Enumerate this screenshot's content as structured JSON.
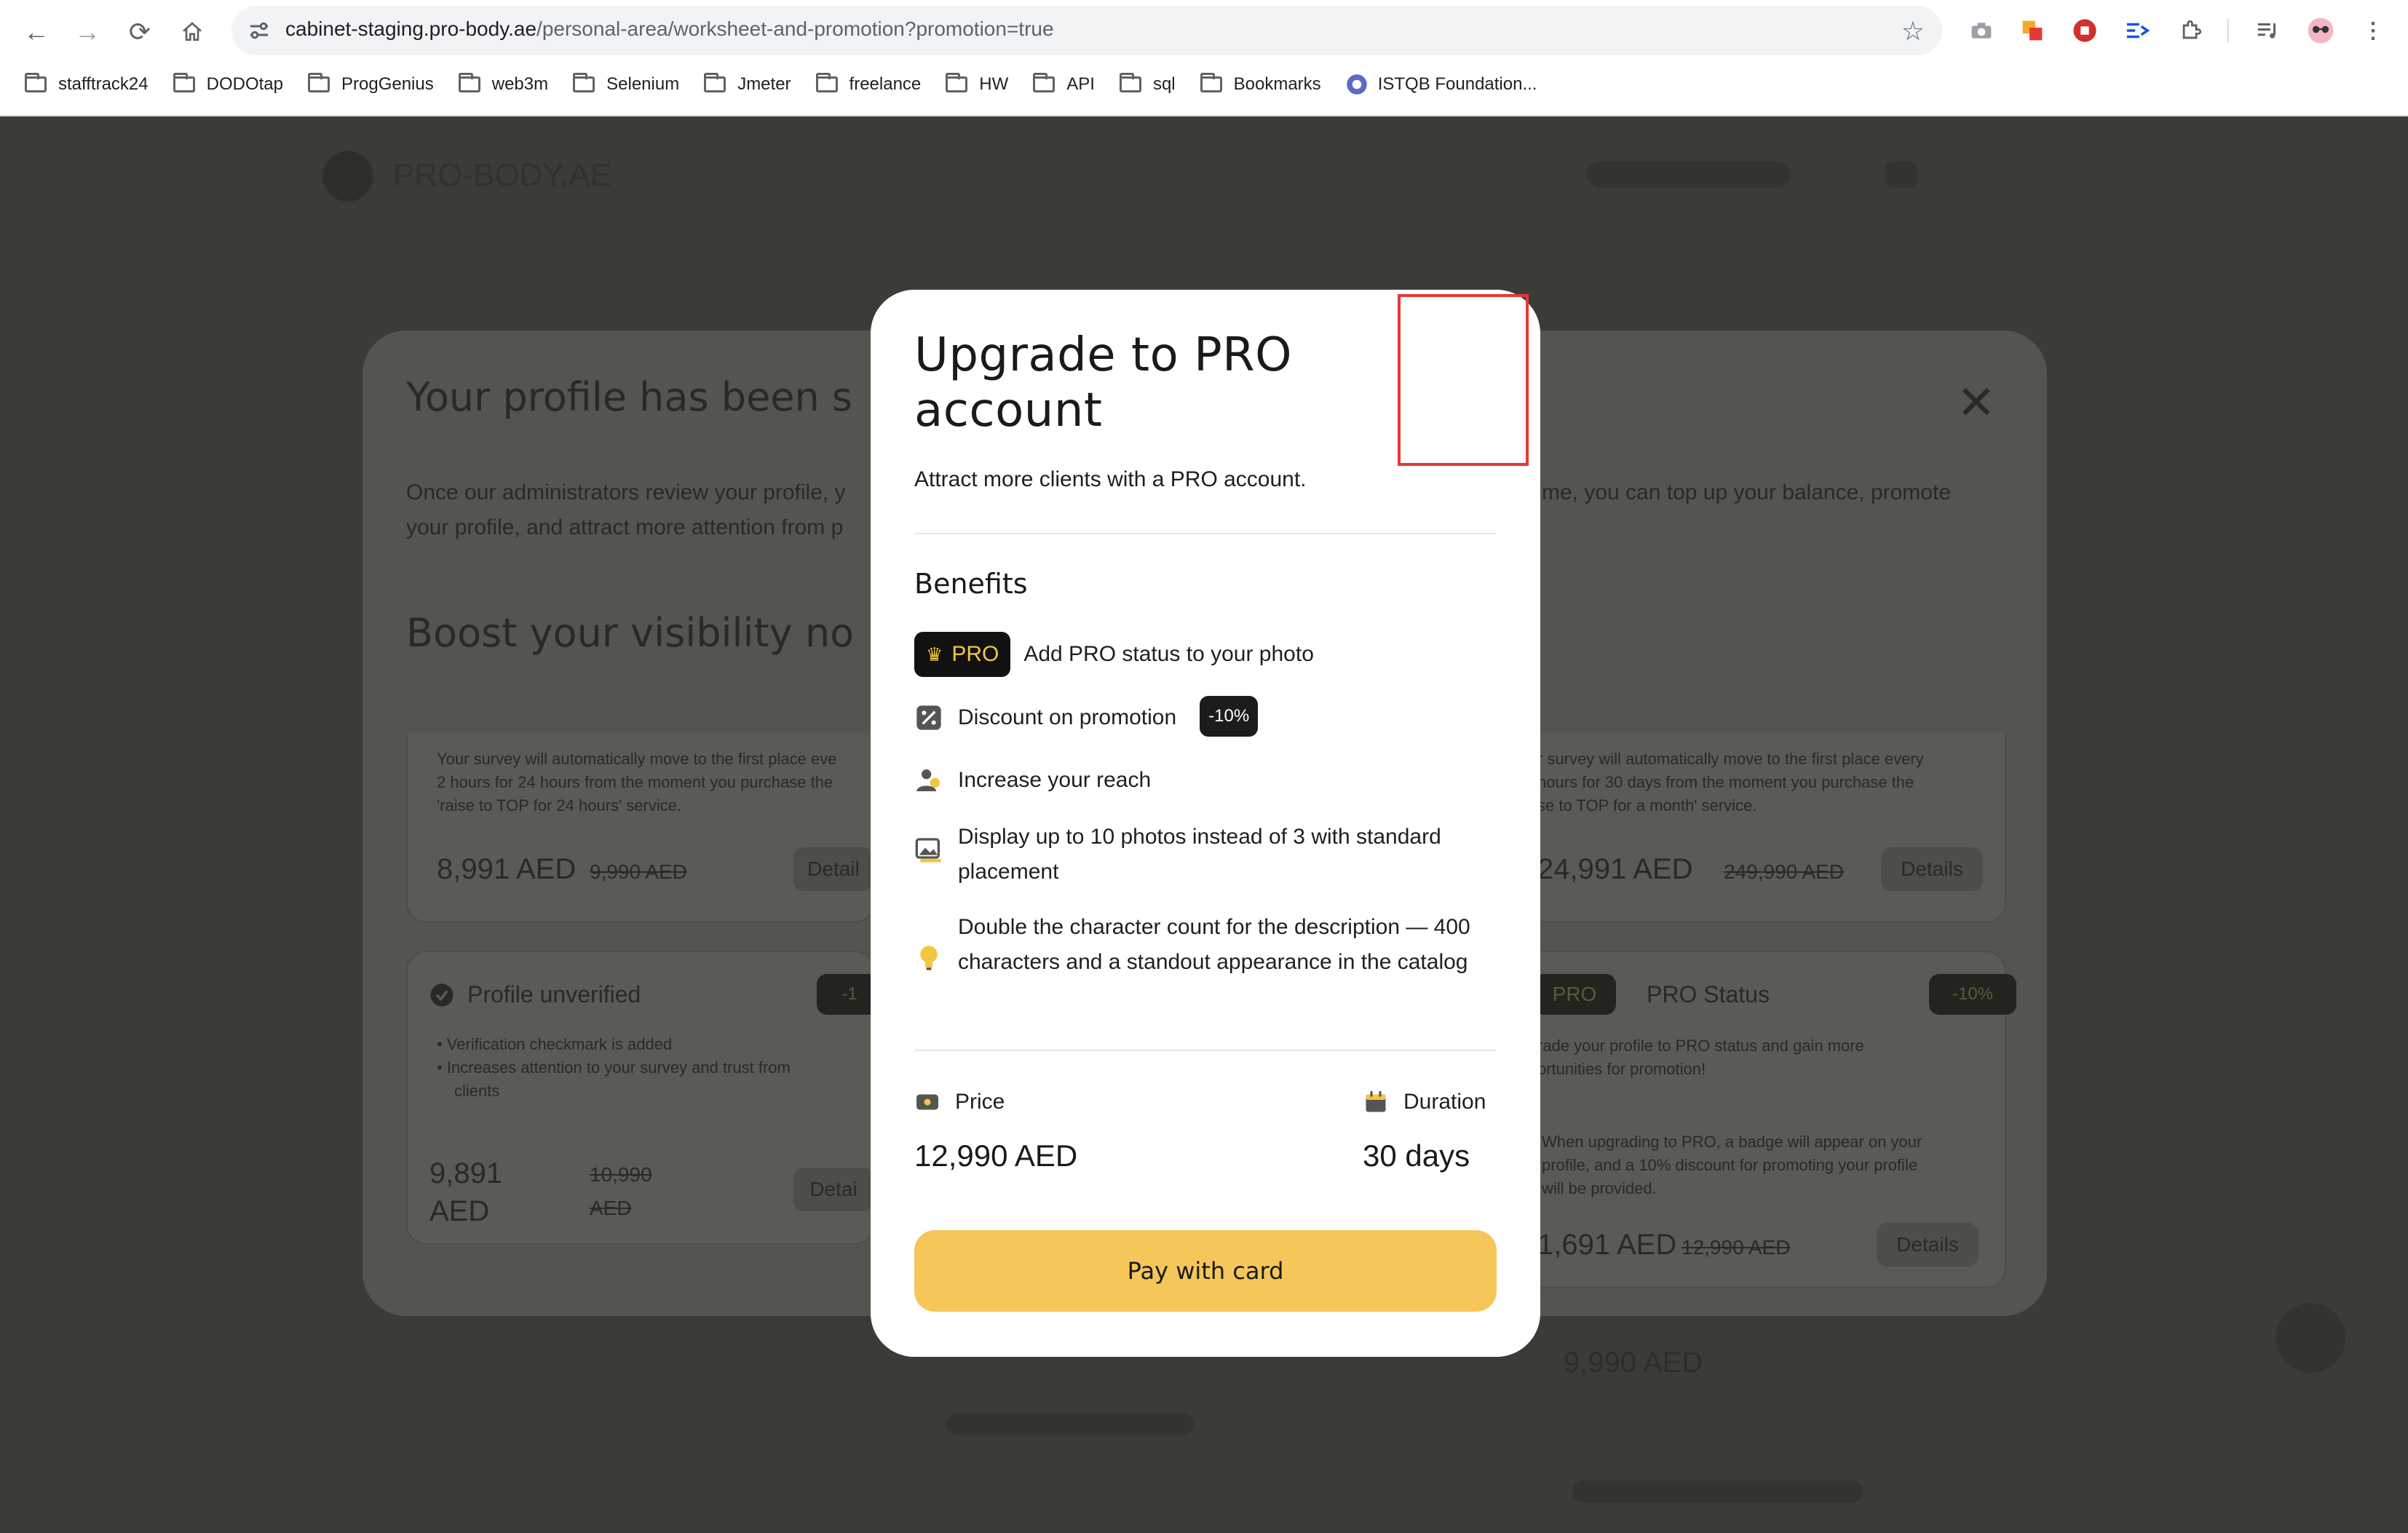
{
  "browser": {
    "url_host": "cabinet-staging.pro-body.ae",
    "url_path": "/personal-area/worksheet-and-promotion?promotion=true",
    "bookmarks": [
      "stafftrack24",
      "DODOtap",
      "ProgGenius",
      "web3m",
      "Selenium",
      "Jmeter",
      "freelance",
      "HW",
      "API",
      "sql",
      "Bookmarks"
    ],
    "istqb_bookmark": "ISTQB Foundation..."
  },
  "background": {
    "logo": "PRO-BODY.AE",
    "heading": "Your profile has been s",
    "desc_left_1": "Once our administrators review your profile, y",
    "desc_left_2": "your profile, and attract more attention from p",
    "desc_right": "me, you can top up your balance, promote",
    "boost_heading": "Boost your visibility no",
    "card1": {
      "text_1": "Your survey will automatically move to the first place eve",
      "text_2": "2 hours for 24 hours from the moment you purchase the",
      "text_3": "'raise to TOP for 24 hours' service.",
      "price": "8,991 AED",
      "old_price": "9,990 AED",
      "details": "Detail"
    },
    "card2": {
      "text_1": "r survey will automatically move to the first place every",
      "text_2": "hours for 30 days from the moment you purchase the",
      "text_3": "se to TOP for a month' service.",
      "price": "24,991 AED",
      "old_price": "249,990 AED",
      "details": "Details"
    },
    "card3": {
      "title": "Profile unverified",
      "bullet_1": "Verification checkmark is added",
      "bullet_2": "Increases attention to your survey and trust from",
      "bullet_2b": "clients",
      "price_1": "9,891",
      "price_2": "AED",
      "old_price_1": "10,990",
      "old_price_2": "AED",
      "details": "Detai",
      "badge": "-1"
    },
    "card4": {
      "pro": "PRO",
      "title": "PRO Status",
      "badge": "-10%",
      "text_1": "rade your profile to PRO status and gain more",
      "text_2": "ortunities for promotion!",
      "note_1": "When upgrading to PRO, a badge will appear on your",
      "note_2": "profile, and a 10% discount for promoting your profile",
      "note_3": "will be provided.",
      "price": "1,691 AED",
      "old_price": "12,990 AED",
      "details": "Details"
    },
    "footer_price": "9,990 AED"
  },
  "modal": {
    "title": "Upgrade to PRO account",
    "subtitle": "Attract more clients with a PRO account.",
    "benefits_heading": "Benefits",
    "pro_badge": "PRO",
    "benefit_pro": "Add PRO status to your photo",
    "benefit_discount": "Discount on promotion",
    "discount_badge": "-10%",
    "benefit_reach": "Increase your reach",
    "benefit_photos": "Display up to 10 photos instead of 3 with standard placement",
    "benefit_chars": "Double the character count for the description — 400 characters and a standout appearance in the catalog",
    "price_label": "Price",
    "price_value": "12,990 AED",
    "duration_label": "Duration",
    "duration_value": "30 days",
    "pay_button": "Pay with card"
  },
  "colors": {
    "accent": "#f5c65a",
    "pro_gold": "#f4c542",
    "overlay": "#3b3b38",
    "highlight_box": "#e53935"
  }
}
